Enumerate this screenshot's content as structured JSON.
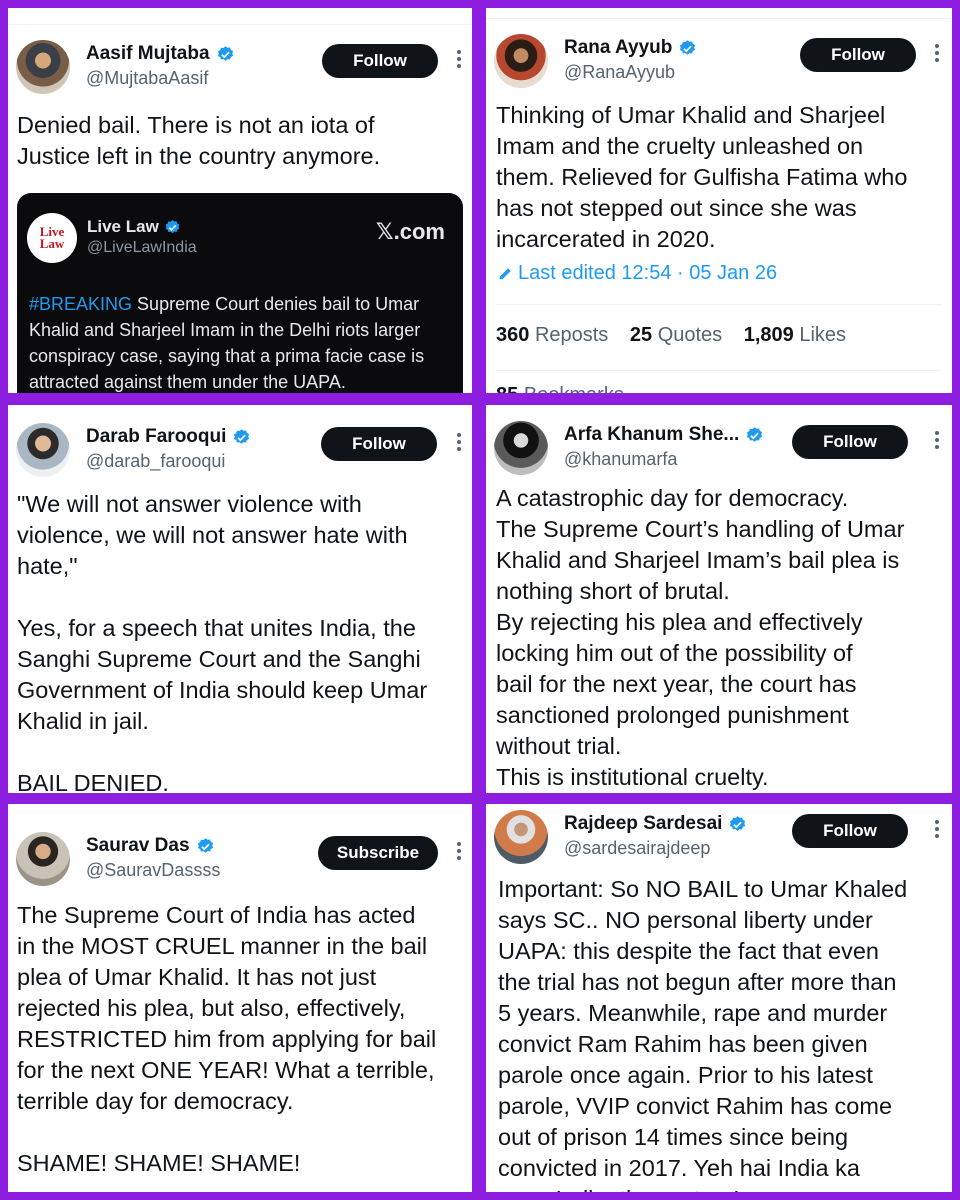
{
  "cards": [
    {
      "name": "Aasif Mujtaba",
      "handle": "@MujtabaAasif",
      "button": "Follow",
      "text": "Denied bail. There is not an iota of\nJustice left in the country anymore.",
      "quote": {
        "name": "Live Law",
        "handle": "@LiveLawIndia",
        "brand": "𝕏.com",
        "logo_top": "Live",
        "logo_bottom": "Law",
        "hashtag": "#BREAKING",
        "text": " Supreme Court denies bail to Umar Khalid and Sharjeel Imam in the Delhi riots larger conspiracy case, saying that a prima facie case is attracted against them under the UAPA."
      }
    },
    {
      "name": "Rana Ayyub",
      "handle": "@RanaAyyub",
      "button": "Follow",
      "text": "Thinking of Umar Khalid and Sharjeel\nImam and the cruelty unleashed on\nthem. Relieved for Gulfisha Fatima who\nhas not stepped out since she was\nincarcerated in 2020.",
      "edited": "Last edited 12:54 · 05 Jan 26",
      "stats": {
        "reposts": "360",
        "reposts_label": "Reposts",
        "quotes": "25",
        "quotes_label": "Quotes",
        "likes": "1,809",
        "likes_label": "Likes",
        "bookmarks": "85",
        "bookmarks_label": "Bookmarks"
      }
    },
    {
      "name": "Darab Farooqui",
      "handle": "@darab_farooqui",
      "button": "Follow",
      "text": "\"We will not answer violence with\nviolence, we will not answer hate with\nhate,\"\n\nYes, for a speech that unites India, the\nSanghi Supreme Court and the Sanghi\nGovernment of India should keep Umar\nKhalid in jail.\n\nBAIL DENIED."
    },
    {
      "name": "Arfa Khanum She...",
      "handle": "@khanumarfa",
      "button": "Follow",
      "text": "A catastrophic day for democracy.\nThe Supreme Court’s handling of Umar\nKhalid and Sharjeel Imam’s bail plea is\nnothing short of brutal.\nBy rejecting his plea and effectively\nlocking him out of the possibility of\nbail for the next year, the court has\nsanctioned prolonged punishment\nwithout trial.\nThis is institutional cruelty."
    },
    {
      "name": "Saurav Das",
      "handle": "@SauravDassss",
      "button": "Subscribe",
      "text": "The Supreme Court of India has acted\nin the MOST CRUEL manner in the bail\nplea of Umar Khalid. It has not just\nrejected his plea, but also, effectively,\nRESTRICTED him from applying for bail\nfor the next ONE YEAR! What a terrible,\nterrible day for democracy.\n\nSHAME! SHAME! SHAME!"
    },
    {
      "name": "Rajdeep Sardesai",
      "handle": "@sardesairajdeep",
      "button": "Follow",
      "text": "Important: So NO BAIL to Umar Khaled\nsays SC.. NO personal liberty under\nUAPA: this despite the fact that even\nthe trial has not begun after more than\n5 years. Meanwhile, rape and murder\nconvict Ram Rahim has been given\nparole once again. Prior to his latest\nparole, VVIP convict Rahim has come\nout of prison 14 times since being\nconvicted in 2017. Yeh hai India ka\nnaya India: the system!"
    }
  ],
  "colors": {
    "frame": "#8f1fe0",
    "verified": "#1d9bf0",
    "button": "#0f1419",
    "link": "#1d9bf0"
  },
  "icons": {
    "verified": "verified-badge-icon",
    "more": "more-options-icon",
    "edit": "pencil-icon",
    "avatar": "avatar"
  }
}
